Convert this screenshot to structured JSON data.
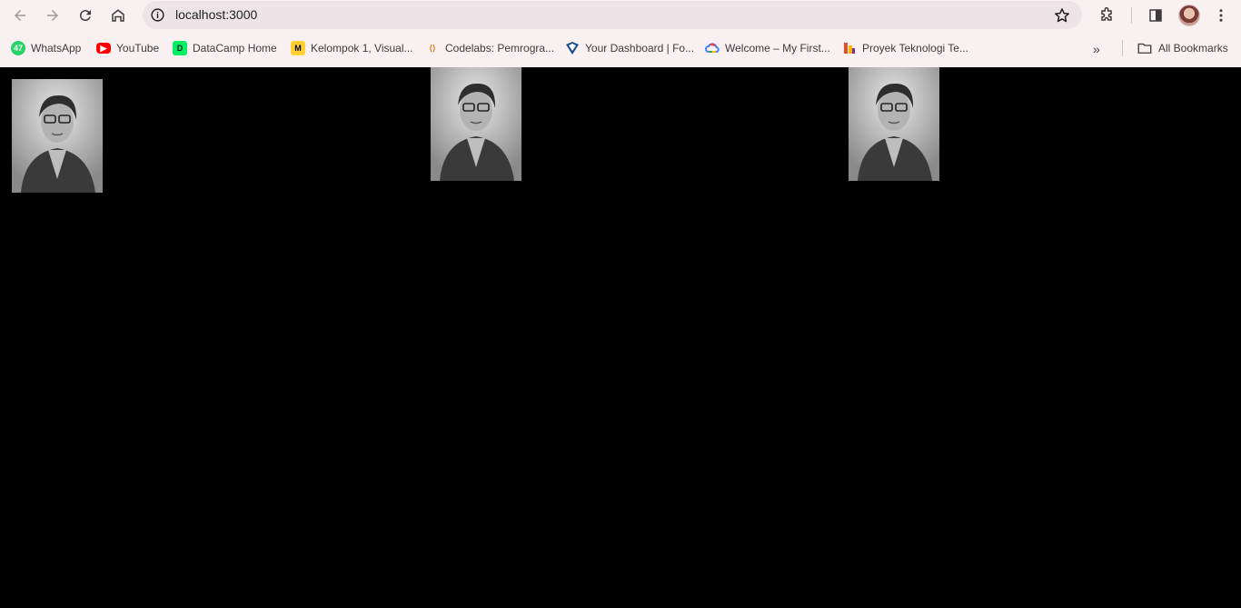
{
  "browser": {
    "url": "localhost:3000",
    "all_bookmarks_label": "All Bookmarks"
  },
  "bookmarks": [
    {
      "label": "WhatsApp",
      "icon": "whatsapp-icon",
      "badge": "47",
      "color": "#25d366"
    },
    {
      "label": "YouTube",
      "icon": "youtube-icon",
      "color": "#ff0000"
    },
    {
      "label": "DataCamp Home",
      "icon": "datacamp-icon",
      "color": "#03ef62"
    },
    {
      "label": "Kelompok 1, Visual...",
      "icon": "miro-icon",
      "color": "#ffd02f"
    },
    {
      "label": "Codelabs: Pemrogra...",
      "icon": "codelabs-icon",
      "color": "#e8710a"
    },
    {
      "label": "Your Dashboard | Fo...",
      "icon": "dashboard-icon",
      "color": "#1a4e8a"
    },
    {
      "label": "Welcome – My First...",
      "icon": "google-cloud-icon",
      "color": "#4285f4"
    },
    {
      "label": "Proyek Teknologi Te...",
      "icon": "jira-icon",
      "color": "#e44d26"
    }
  ],
  "page": {
    "background": "#000000",
    "images": [
      {
        "alt": "portrait"
      },
      {
        "alt": "portrait"
      },
      {
        "alt": "portrait"
      }
    ]
  }
}
